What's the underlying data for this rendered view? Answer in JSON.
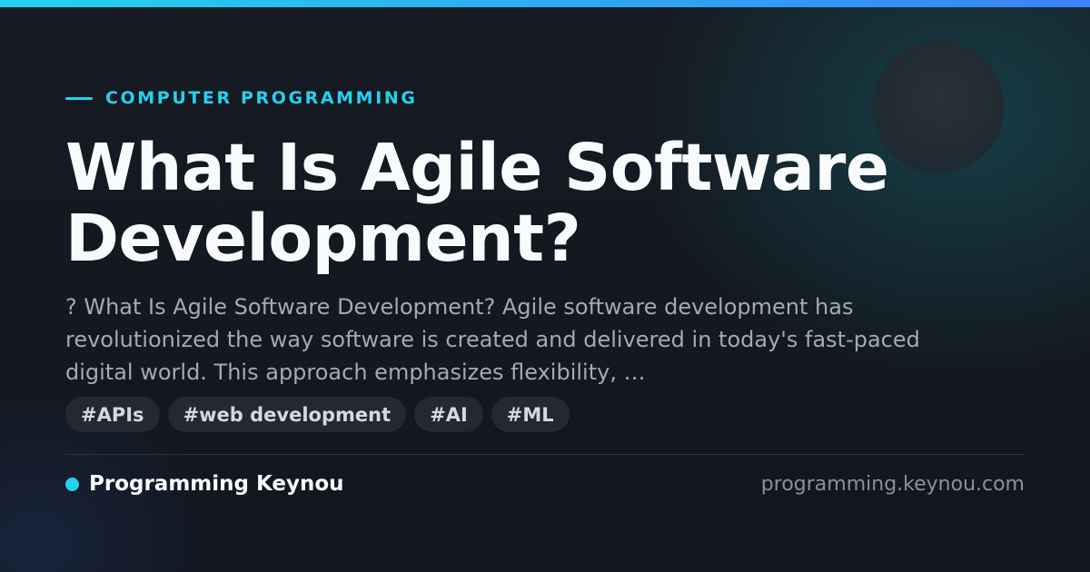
{
  "colors": {
    "accent": "#22d3ee",
    "accent_gradient_end": "#3b82f6",
    "background": "#12161e",
    "title": "#f8fafc",
    "excerpt": "#a3a9b5",
    "tag_background": "#232833",
    "tag_text": "#d4d8df",
    "muted": "#8a909c"
  },
  "icons": {
    "category_marker": "dash-line-icon",
    "brand_marker": "dot-icon"
  },
  "category": {
    "label": "COMPUTER PROGRAMMING"
  },
  "article": {
    "title": "What Is Agile Software Development?",
    "excerpt": "? What Is Agile Software Development? Agile software development has revolutionized the way software is created and delivered in today's fast-paced digital world. This approach emphasizes flexibility, …"
  },
  "tags": [
    {
      "label": "#APIs"
    },
    {
      "label": "#web development"
    },
    {
      "label": "#AI"
    },
    {
      "label": "#ML"
    }
  ],
  "footer": {
    "brand_name": "Programming Keynou",
    "site_url": "programming.keynou.com"
  }
}
